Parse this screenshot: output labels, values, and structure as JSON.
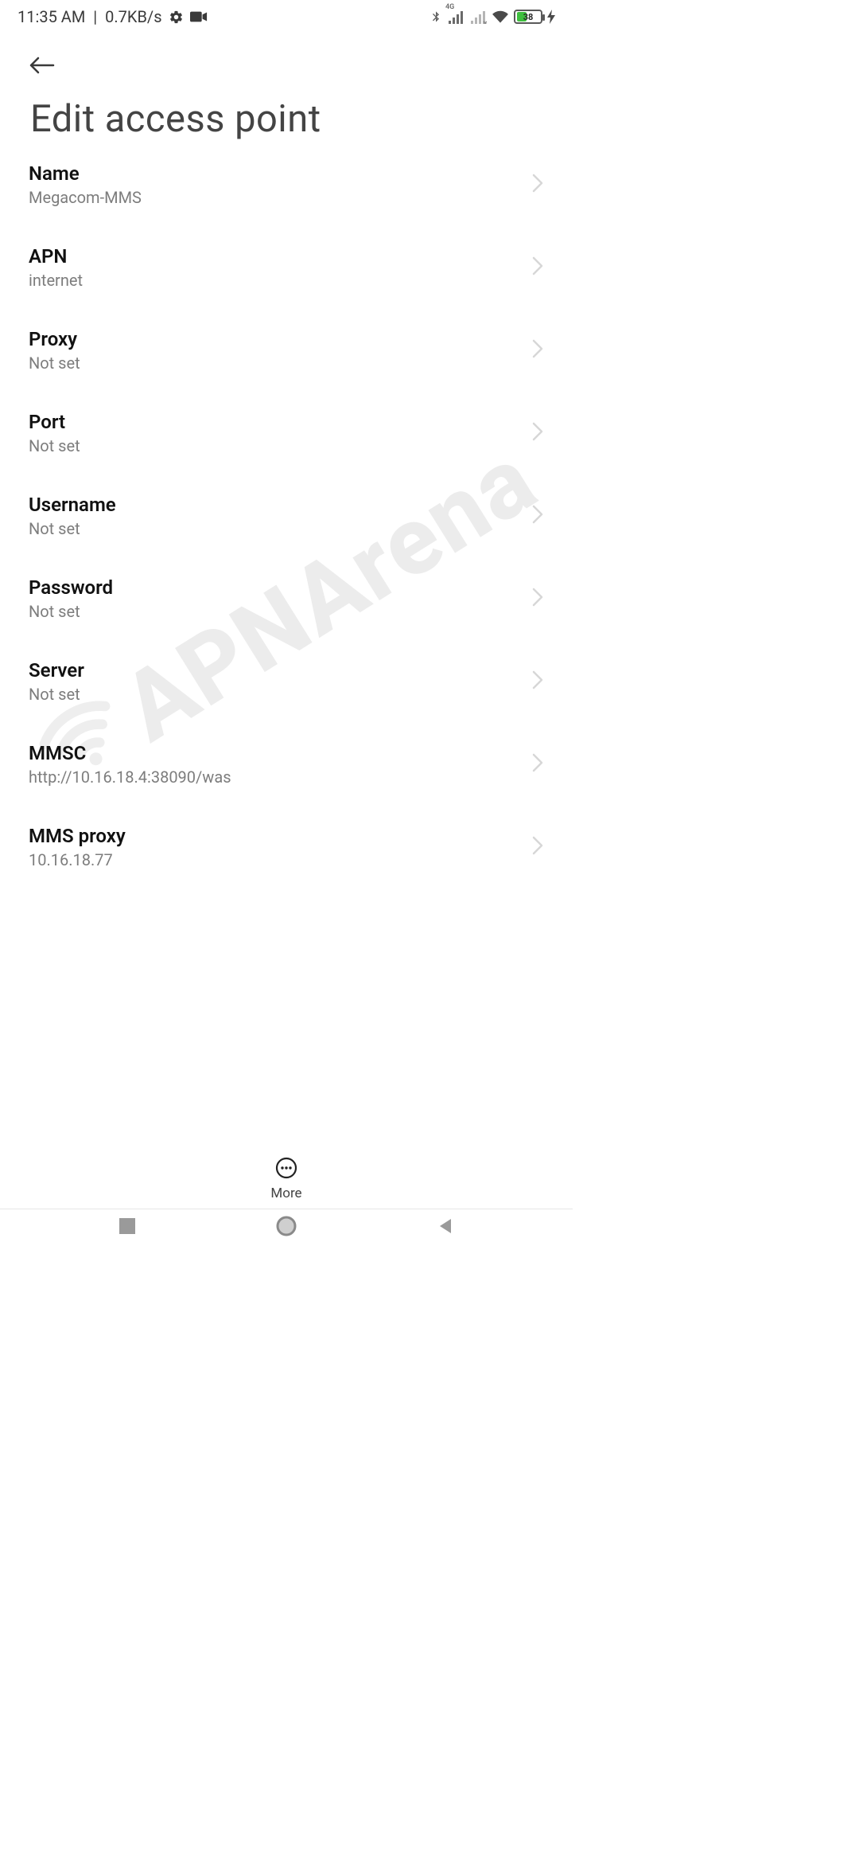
{
  "status": {
    "time": "11:35 AM",
    "net_speed": "0.7KB/s",
    "net_badge": "4G",
    "battery_pct": "38"
  },
  "header": {
    "title": "Edit access point"
  },
  "settings": [
    {
      "key": "name",
      "label": "Name",
      "value": "Megacom-MMS"
    },
    {
      "key": "apn",
      "label": "APN",
      "value": "internet"
    },
    {
      "key": "proxy",
      "label": "Proxy",
      "value": "Not set"
    },
    {
      "key": "port",
      "label": "Port",
      "value": "Not set"
    },
    {
      "key": "username",
      "label": "Username",
      "value": "Not set"
    },
    {
      "key": "password",
      "label": "Password",
      "value": "Not set"
    },
    {
      "key": "server",
      "label": "Server",
      "value": "Not set"
    },
    {
      "key": "mmsc",
      "label": "MMSC",
      "value": "http://10.16.18.4:38090/was"
    },
    {
      "key": "mmsproxy",
      "label": "MMS proxy",
      "value": "10.16.18.77"
    }
  ],
  "dock": {
    "more_label": "More"
  },
  "watermark": {
    "text": "APNArena"
  }
}
